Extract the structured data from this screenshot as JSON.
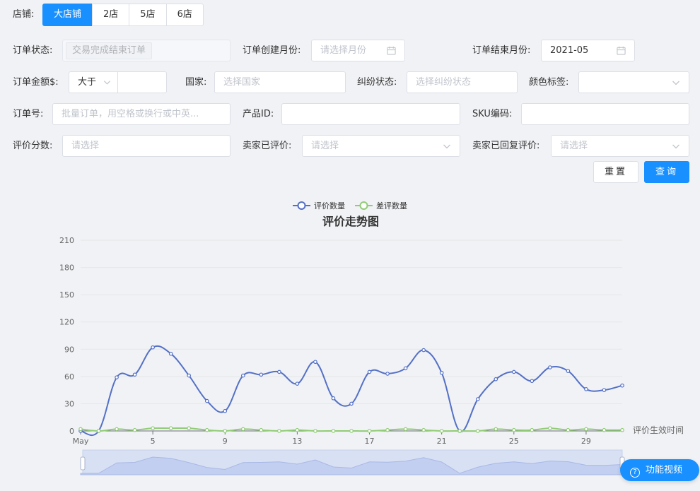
{
  "filters": {
    "store_label": "店铺:",
    "stores": [
      "大店铺",
      "2店",
      "5店",
      "6店"
    ],
    "active_store": 0,
    "order_status_label": "订单状态:",
    "order_status_value": "交易完成结束订单",
    "order_create_month_label": "订单创建月份:",
    "order_create_month_placeholder": "请选择月份",
    "order_end_month_label": "订单结束月份:",
    "order_end_month_value": "2021-05",
    "order_amount_label": "订单金额$:",
    "order_amount_operator": "大于",
    "order_amount_value": "",
    "country_label": "国家:",
    "country_placeholder": "选择国家",
    "dispute_label": "纠纷状态:",
    "dispute_placeholder": "选择纠纷状态",
    "color_tag_label": "颜色标签:",
    "color_tag_value": "",
    "order_no_label": "订单号:",
    "order_no_placeholder": "批量订单，用空格或换行或中英...",
    "product_id_label": "产品ID:",
    "product_id_value": "",
    "sku_label": "SKU编码:",
    "sku_value": "",
    "rating_label": "评价分数:",
    "rating_placeholder": "请选择",
    "seller_rated_label": "卖家已评价:",
    "seller_rated_placeholder": "请选择",
    "seller_replied_label": "卖家已回复评价:",
    "seller_replied_placeholder": "请选择",
    "reset_label": "重置",
    "query_label": "查询"
  },
  "float_button": {
    "label": "功能视频",
    "icon": "question-circle-icon"
  },
  "colors": {
    "primary": "#1890ff",
    "series_review": "#5470c6",
    "series_bad": "#91cc75"
  },
  "chart_data": {
    "type": "line",
    "title": "评价走势图",
    "legend_position": "top-center",
    "xlabel": "评价生效时间",
    "ylabel": "",
    "ylim": [
      0,
      210
    ],
    "yticks": [
      0,
      30,
      60,
      90,
      120,
      150,
      180,
      210
    ],
    "x": [
      "May",
      "2",
      "3",
      "4",
      "5",
      "6",
      "7",
      "8",
      "9",
      "10",
      "11",
      "12",
      "13",
      "14",
      "15",
      "16",
      "17",
      "18",
      "19",
      "20",
      "21",
      "22",
      "23",
      "24",
      "25",
      "26",
      "27",
      "28",
      "29",
      "30",
      "31"
    ],
    "xtick_labels": [
      "May",
      "5",
      "9",
      "13",
      "17",
      "21",
      "25",
      "29"
    ],
    "series": [
      {
        "name": "评价数量",
        "values": [
          0,
          0,
          59,
          62,
          92,
          85,
          61,
          33,
          22,
          61,
          62,
          65,
          52,
          76,
          36,
          30,
          65,
          63,
          69,
          89,
          64,
          0,
          35,
          57,
          65,
          55,
          70,
          66,
          46,
          45,
          50
        ]
      },
      {
        "name": "差评数量",
        "values": [
          2,
          0,
          2,
          1,
          3,
          3,
          3,
          1,
          0,
          2,
          1,
          0,
          1,
          0,
          0,
          0,
          0,
          1,
          2,
          1,
          0,
          0,
          0,
          2,
          1,
          1,
          3,
          1,
          2,
          1,
          1
        ]
      }
    ],
    "grid": true,
    "data_zoom": true
  }
}
